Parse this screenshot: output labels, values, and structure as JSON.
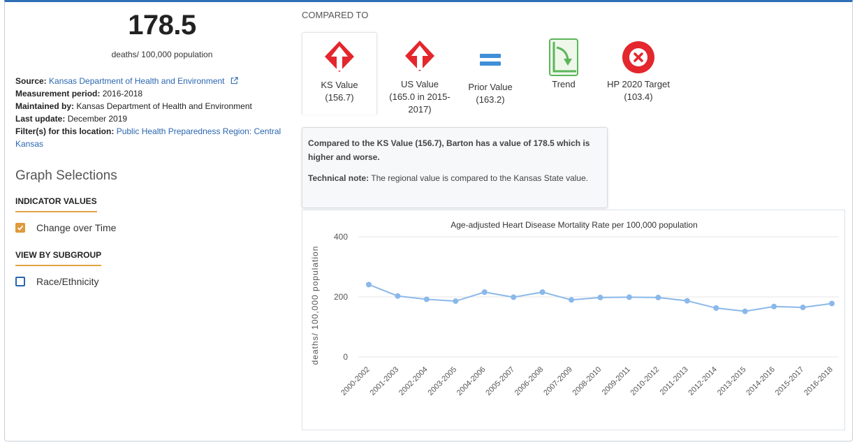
{
  "summary": {
    "value": "178.5",
    "unit": "deaths/ 100,000 population"
  },
  "meta": {
    "source_label": "Source:",
    "source_value": "Kansas Department of Health and Environment",
    "period_label": "Measurement period:",
    "period_value": "2016-2018",
    "maintained_label": "Maintained by:",
    "maintained_value": "Kansas Department of Health and Environment",
    "update_label": "Last update:",
    "update_value": "December 2019",
    "filter_label": "Filter(s) for this location:",
    "filter_value": "Public Health Preparedness Region: Central Kansas"
  },
  "graph_selections": {
    "title": "Graph Selections",
    "indicator_head": "INDICATOR VALUES",
    "change_over_time": "Change over Time",
    "subgroup_head": "VIEW BY SUBGROUP",
    "race_ethnicity": "Race/Ethnicity"
  },
  "compare": {
    "label": "COMPARED TO",
    "ks": {
      "line1": "KS Value",
      "line2": "(156.7)"
    },
    "us": {
      "line1": "US Value",
      "line2": "(165.0 in 2015-",
      "line3": "2017)"
    },
    "prior": {
      "line1": "Prior Value",
      "line2": "(163.2)"
    },
    "trend": {
      "line1": "Trend"
    },
    "hp": {
      "line1": "HP 2020 Target",
      "line2": "(103.4)"
    }
  },
  "tooltip": {
    "line1": "Compared to the KS Value (156.7), Barton has a value of 178.5 which is",
    "line2": "higher and worse.",
    "note_label": "Technical note:",
    "note_value": "The regional value is compared to the Kansas State value."
  },
  "colors": {
    "accent": "#e09a3a",
    "link": "#2a66b0",
    "bad_red": "#e4262d",
    "prior_blue": "#3f8fd7",
    "trend_green": "#5db55a",
    "line": "#8ab8ea"
  },
  "icons": {
    "ks": "red-diamond-up-arrow-icon",
    "us": "red-diamond-up-arrow-icon",
    "prior": "equals-icon",
    "trend": "trend-down-arrow-icon",
    "hp": "red-circle-x-icon"
  },
  "chart_data": {
    "type": "line",
    "title": "Age-adjusted Heart Disease Mortality Rate per 100,000 population",
    "ylabel": "deaths/ 100,000 population",
    "xlabel": "",
    "ylim": [
      0,
      400
    ],
    "yticks": [
      0,
      200,
      400
    ],
    "grid": true,
    "categories": [
      "2000-2002",
      "2001-2003",
      "2002-2004",
      "2003-2005",
      "2004-2006",
      "2005-2007",
      "2006-2008",
      "2007-2009",
      "2008-2010",
      "2009-2011",
      "2010-2012",
      "2011-2013",
      "2012-2014",
      "2013-2015",
      "2014-2016",
      "2015-2017",
      "2016-2018"
    ],
    "values": [
      241,
      203,
      192,
      186,
      216,
      199,
      216,
      190,
      198,
      199,
      198,
      187,
      163,
      152,
      168,
      165,
      178
    ]
  }
}
